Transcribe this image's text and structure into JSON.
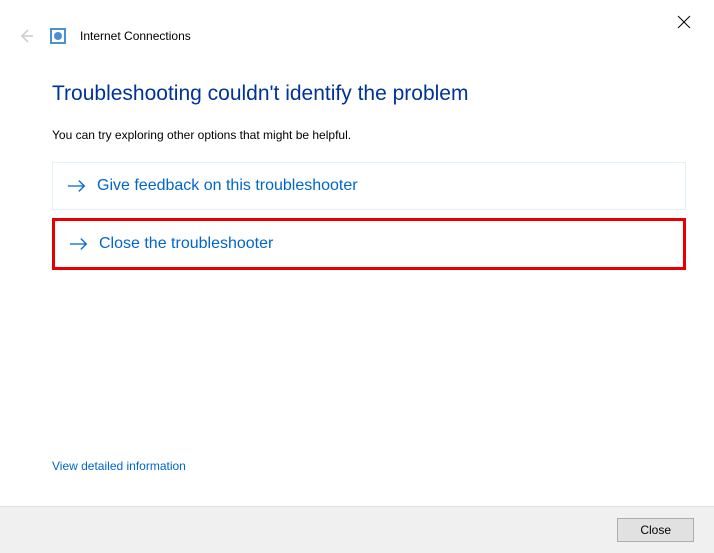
{
  "window": {
    "title": "Internet Connections"
  },
  "content": {
    "heading": "Troubleshooting couldn't identify the problem",
    "subtitle": "You can try exploring other options that might be helpful."
  },
  "options": {
    "feedback": "Give feedback on this troubleshooter",
    "close_troubleshooter": "Close the troubleshooter"
  },
  "links": {
    "detail": "View detailed information"
  },
  "footer": {
    "close": "Close"
  }
}
